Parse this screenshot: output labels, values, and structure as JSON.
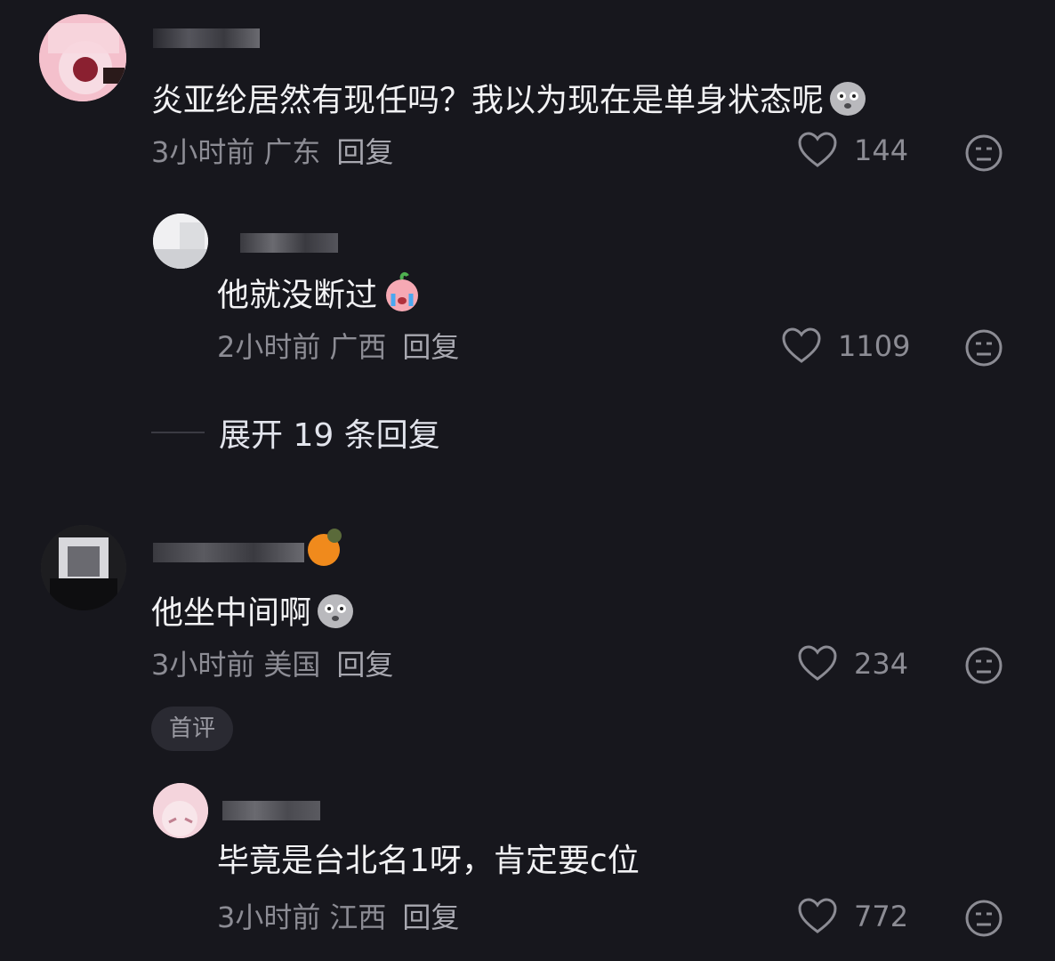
{
  "comments": [
    {
      "text": "炎亚纶居然有现任吗？我以为现在是单身状态呢",
      "emoji": "shocked-pigeon-emoji",
      "time": "3小时前",
      "location": "广东",
      "reply_label": "回复",
      "likes": "144"
    },
    {
      "text": "他就没断过",
      "emoji": "crying-peach-emoji",
      "time": "2小时前",
      "location": "广西",
      "reply_label": "回复",
      "likes": "1109"
    },
    {
      "text": "他坐中间啊",
      "emoji": "shocked-pigeon-emoji",
      "time": "3小时前",
      "location": "美国",
      "reply_label": "回复",
      "likes": "234",
      "badge": "首评"
    },
    {
      "text": "毕竟是台北名1呀，肯定要c位",
      "time": "3小时前",
      "location": "江西",
      "reply_label": "回复",
      "likes": "772"
    }
  ],
  "expand_replies": "展开 19 条回复",
  "colors": {
    "background": "#17171d",
    "text_primary": "#f2f2f4",
    "text_secondary": "#8c8c94",
    "badge_bg": "#2a2a32"
  }
}
